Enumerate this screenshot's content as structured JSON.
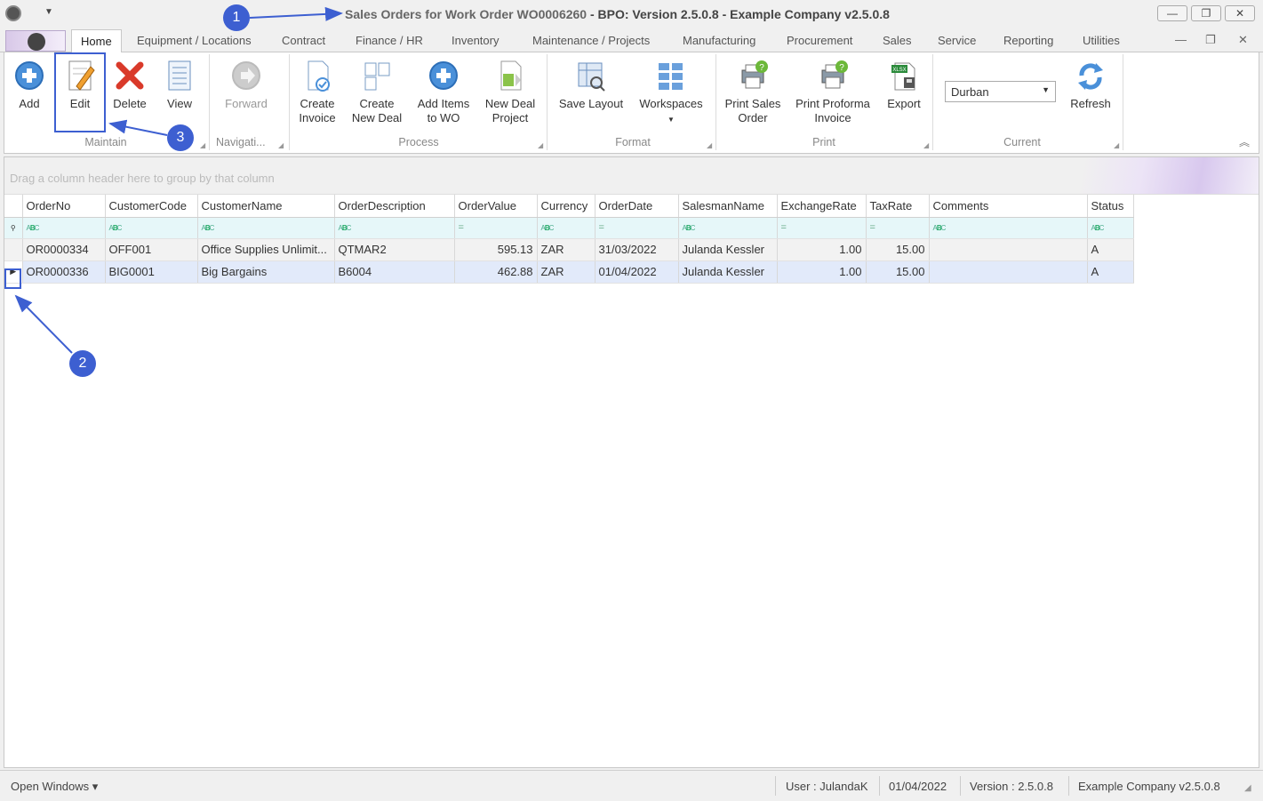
{
  "window": {
    "title_prefix": "Sales Orders for Work Order WO0006260",
    "title_rest": " - BPO: Version 2.5.0.8 - Example Company v2.5.0.8",
    "minimize": "—",
    "maximize": "❐",
    "close": "✕"
  },
  "tabs": [
    {
      "label": "Home"
    },
    {
      "label": "Equipment / Locations"
    },
    {
      "label": "Contract"
    },
    {
      "label": "Finance / HR"
    },
    {
      "label": "Inventory"
    },
    {
      "label": "Maintenance / Projects"
    },
    {
      "label": "Manufacturing"
    },
    {
      "label": "Procurement"
    },
    {
      "label": "Sales"
    },
    {
      "label": "Service"
    },
    {
      "label": "Reporting"
    },
    {
      "label": "Utilities"
    }
  ],
  "ribbon": {
    "maintain": {
      "label": "Maintain",
      "add": "Add",
      "edit": "Edit",
      "delete": "Delete",
      "view": "View"
    },
    "navigation": {
      "label": "Navigati...",
      "forward": "Forward"
    },
    "process": {
      "label": "Process",
      "create_invoice_1": "Create",
      "create_invoice_2": "Invoice",
      "create_deal_1": "Create",
      "create_deal_2": "New Deal",
      "add_items_1": "Add Items",
      "add_items_2": "to WO",
      "new_deal_project_1": "New Deal",
      "new_deal_project_2": "Project"
    },
    "format": {
      "label": "Format",
      "save_layout": "Save Layout",
      "workspaces": "Workspaces"
    },
    "print": {
      "label": "Print",
      "print_so_1": "Print Sales",
      "print_so_2": "Order",
      "print_proforma_1": "Print Proforma",
      "print_proforma_2": "Invoice",
      "export": "Export"
    },
    "current": {
      "label": "Current",
      "site": "Durban",
      "refresh": "Refresh"
    }
  },
  "grid": {
    "group_hint": "Drag a column header here to group by that column",
    "columns": [
      "OrderNo",
      "CustomerCode",
      "CustomerName",
      "OrderDescription",
      "OrderValue",
      "Currency",
      "OrderDate",
      "SalesmanName",
      "ExchangeRate",
      "TaxRate",
      "Comments",
      "Status"
    ],
    "rows": [
      [
        "OR0000334",
        "OFF001",
        "Office Supplies Unlimit...",
        "QTMAR2",
        "595.13",
        "ZAR",
        "31/03/2022",
        "Julanda Kessler",
        "1.00",
        "15.00",
        "",
        "A"
      ],
      [
        "OR0000336",
        "BIG0001",
        "Big Bargains",
        "B6004",
        "462.88",
        "ZAR",
        "01/04/2022",
        "Julanda Kessler",
        "1.00",
        "15.00",
        "",
        "A"
      ]
    ]
  },
  "statusbar": {
    "open_windows": "Open Windows ▾",
    "user": "User : JulandaK",
    "date": "01/04/2022",
    "version": "Version : 2.5.0.8",
    "company": "Example Company v2.5.0.8"
  },
  "callouts": {
    "one": "1",
    "two": "2",
    "three": "3"
  },
  "colors": {
    "accent": "#3d5fd1",
    "selected_row": "#e2eafa",
    "filter_row": "#e6f7f9"
  }
}
